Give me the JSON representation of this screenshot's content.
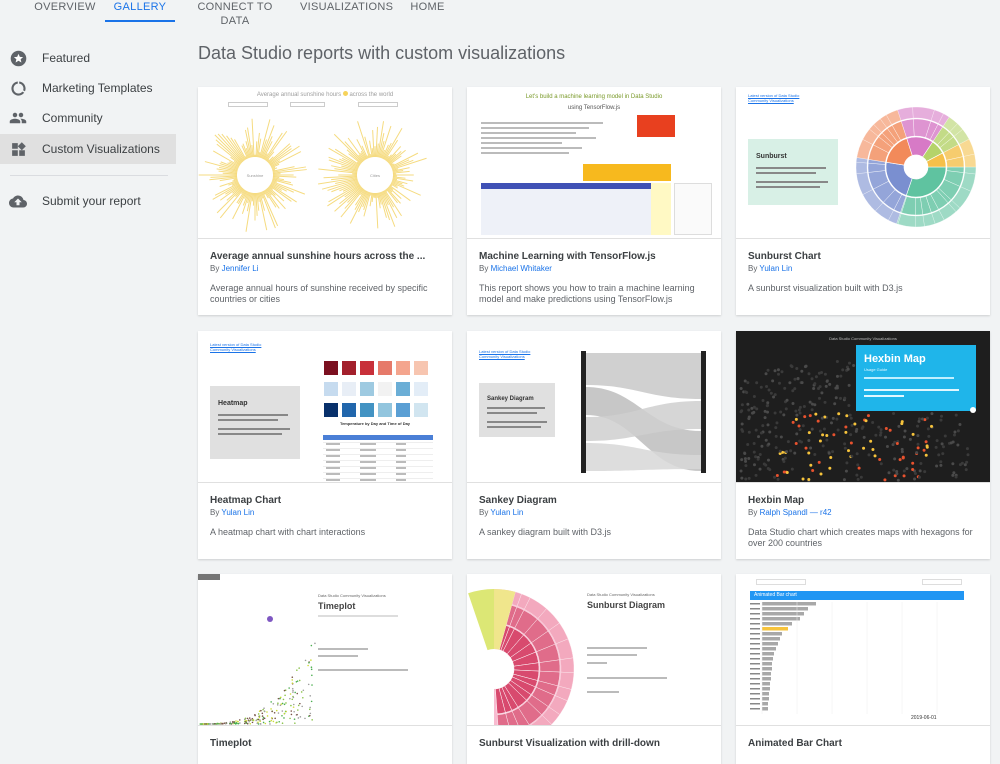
{
  "nav": {
    "tabs": [
      "OVERVIEW",
      "GALLERY",
      "CONNECT TO DATA",
      "VISUALIZATIONS",
      "HOME"
    ],
    "active": "GALLERY"
  },
  "sidebar": {
    "items": [
      {
        "label": "Featured",
        "icon": "star-icon"
      },
      {
        "label": "Marketing Templates",
        "icon": "donut-icon"
      },
      {
        "label": "Community",
        "icon": "people-icon"
      },
      {
        "label": "Custom Visualizations",
        "icon": "widgets-icon"
      },
      {
        "label": "Submit your report",
        "icon": "cloud-upload-icon"
      }
    ],
    "active": "Custom Visualizations"
  },
  "page": {
    "title": "Data Studio reports with custom visualizations"
  },
  "cards": [
    {
      "title": "Average annual sunshine hours across the ...",
      "by": "By",
      "author": "Jennifer Li",
      "desc": "Average annual hours of sunshine received by specific countries or cities",
      "thumb": {
        "heading": "Average annual sunshine hours",
        "heading2": "across the world",
        "left": "Sunshine",
        "right": "Cities"
      }
    },
    {
      "title": "Machine Learning with TensorFlow.js",
      "by": "By",
      "author": "Michael Whitaker",
      "desc": "This report shows you how to train a machine learning model and make predictions using TensorFlow.js",
      "thumb": {
        "heading": "Let's build a machine learning model in Data Studio",
        "heading2": "using TensorFlow.js"
      }
    },
    {
      "title": "Sunburst Chart",
      "by": "By",
      "author": "Yulan Lin",
      "desc": "A sunburst visualization built with D3.js",
      "thumb": {
        "heading": "Sunburst",
        "link": "Latest version of Data Studio Community Visualizations"
      }
    },
    {
      "title": "Heatmap Chart",
      "by": "By",
      "author": "Yulan Lin",
      "desc": "A heatmap chart with chart interactions",
      "thumb": {
        "heading": "Heatmap",
        "caption": "Temperature by Day and Time of Day",
        "link": "Latest version of Data Studio Community Visualizations"
      }
    },
    {
      "title": "Sankey Diagram",
      "by": "By",
      "author": "Yulan Lin",
      "desc": "A sankey diagram built with D3.js",
      "thumb": {
        "heading": "Sankey Diagram",
        "link": "Latest version of Data Studio Community Visualizations"
      }
    },
    {
      "title": "Hexbin Map",
      "by": "By",
      "author": "Ralph Spandl — r42",
      "desc": "Data Studio chart which creates maps with hexagons for over 200 countries",
      "thumb": {
        "heading": "Hexbin Map",
        "sub": "Usage Guide",
        "top": "Data Studio Community Visualizations"
      }
    },
    {
      "title": "Timeplot",
      "by": "",
      "author": "",
      "desc": "",
      "thumb": {
        "heading": "Timeplot",
        "top": "Data Studio Community Visualizations"
      }
    },
    {
      "title": "Sunburst Visualization with drill-down",
      "by": "",
      "author": "",
      "desc": "",
      "thumb": {
        "heading": "Sunburst Diagram",
        "top": "Data Studio Community Visualizations"
      }
    },
    {
      "title": "Animated Bar Chart",
      "by": "",
      "author": "",
      "desc": "",
      "thumb": {
        "heading": "Animated Bar chart",
        "date": "2019-06-01"
      }
    }
  ]
}
